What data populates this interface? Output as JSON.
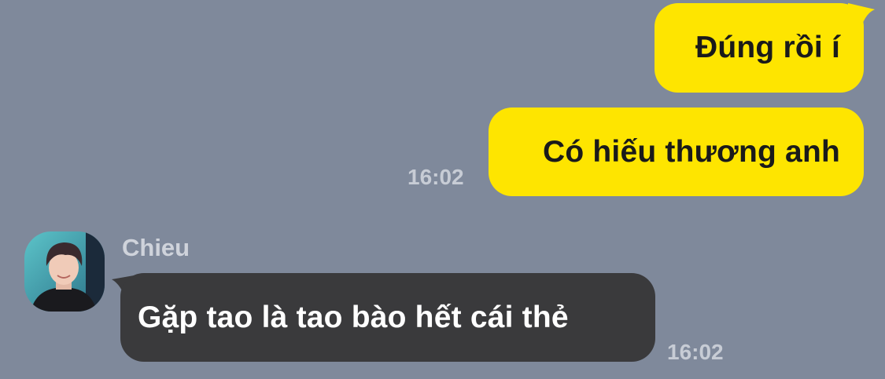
{
  "messages": [
    {
      "direction": "outgoing",
      "text": "Đúng rồi í"
    },
    {
      "direction": "outgoing",
      "text": "Có hiếu thương anh",
      "time": "16:02"
    },
    {
      "direction": "incoming",
      "sender": "Chieu",
      "text": "Gặp tao là tao bào hết cái thẻ",
      "time": "16:02"
    }
  ],
  "colors": {
    "background": "#7f899b",
    "outgoing_bubble": "#fee500",
    "incoming_bubble": "#3a3a3c",
    "timestamp": "#c7ccd5"
  },
  "avatar": {
    "description_icon": "profile-photo"
  }
}
